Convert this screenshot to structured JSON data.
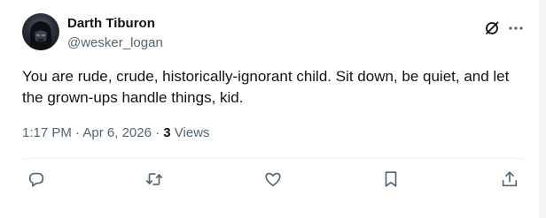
{
  "author": {
    "name": "Darth Tiburon",
    "handle": "@wesker_logan"
  },
  "tweet": {
    "text": "You are rude, crude, historically-ignorant child. Sit down, be quiet, and let the grown-ups handle things, kid."
  },
  "meta": {
    "time": "1:17 PM",
    "separator1": " · ",
    "date": "Apr 6, 2026",
    "separator2": " · ",
    "views_count": "3",
    "views_label": " Views"
  },
  "icons": {
    "grok": "grok-icon",
    "more": "more-icon",
    "reply": "reply-icon",
    "retweet": "retweet-icon",
    "like": "heart-icon",
    "bookmark": "bookmark-icon",
    "share": "share-icon"
  },
  "colors": {
    "text_primary": "#0f1419",
    "text_secondary": "#536471",
    "divider": "#eff3f4"
  }
}
